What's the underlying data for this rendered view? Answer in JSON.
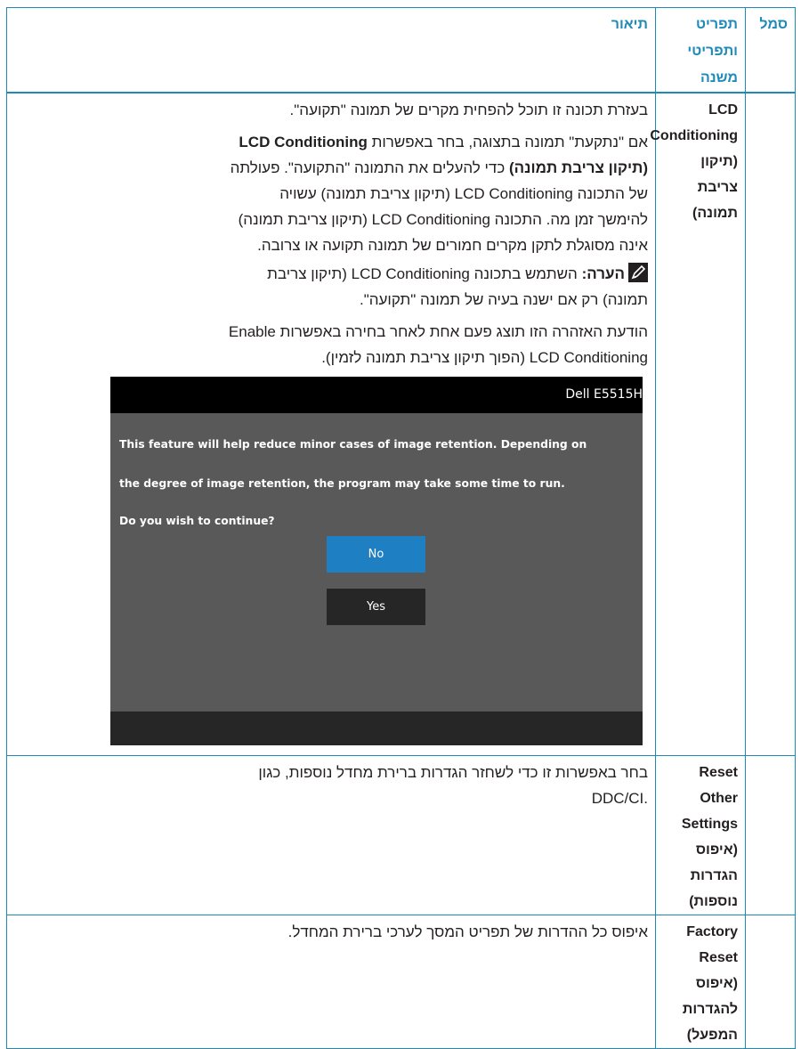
{
  "header": {
    "symbol": "סמל",
    "item_line1": "תפריט",
    "item_line2": "ותפריטי משנה",
    "description": "תיאור"
  },
  "rows": [
    {
      "item_lines": [
        "LCD",
        "Conditioning",
        "(תיקון צריבת",
        "תמונה)"
      ],
      "intro": "בעזרת תכונה זו תוכל להפחית מקרים של תמונה \"תקועה\".",
      "para2_start": "אם \"נתקעת\" תמונה בתצוגה, בחר באפשרות ",
      "para2_bold1": "LCD Conditioning",
      "para2_bold2": "(תיקון צריבת תמונה)",
      "para2_rest1": " כדי להעלים את התמונה \"התקועה\". פעולתה",
      "para2_l3": "של התכונה LCD Conditioning (תיקון צריבת תמונה) עשויה",
      "para2_l4": "להימשך זמן מה. התכונה LCD Conditioning (תיקון צריבת תמונה)",
      "para2_l5": "אינה מסוגלת לתקן מקרים חמורים של תמונה תקועה או צרובה.",
      "note_label": "הערה:",
      "note_l1": " השתמש בתכונה LCD Conditioning (תיקון צריבת",
      "note_l2": "תמונה) רק אם ישנה בעיה של תמונה \"תקועה\".",
      "warn_l1": "הודעת האזהרה הזו תוצג פעם אחת לאחר בחירה באפשרות Enable",
      "warn_l2": "LCD Conditioning (הפוך תיקון צריבת תמונה לזמין).",
      "dialog": {
        "title": "Dell E5515H",
        "line1": "This feature will help reduce minor cases of image retention. Depending on",
        "line2": "the degree of image retention, the program may take some time to run.",
        "line3": "Do you wish to continue?",
        "no_label": "No",
        "yes_label": "Yes"
      }
    },
    {
      "item_lines": [
        "Reset Other",
        "Settings",
        "(איפוס הגדרות",
        "נוספות)"
      ],
      "desc_l1": "בחר באפשרות זו כדי לשחזר הגדרות ברירת מחדל נוספות, כגון",
      "desc_l2": ".DDC/CI"
    },
    {
      "item_lines": [
        "Factory Reset",
        "(איפוס להגדרות",
        "המפעל)"
      ],
      "desc_l1": "איפוס כל ההדרות של תפריט המסך לערכי ברירת המחדל."
    }
  ],
  "colors": {
    "border": "#1e8ab8",
    "header_text": "#1e8ab8",
    "dialog_bg": "#595959",
    "dialog_title_bg": "#000000",
    "no_button": "#1f7fc3",
    "yes_button": "#262626"
  },
  "icons": {
    "note": "pencil-note-icon"
  }
}
